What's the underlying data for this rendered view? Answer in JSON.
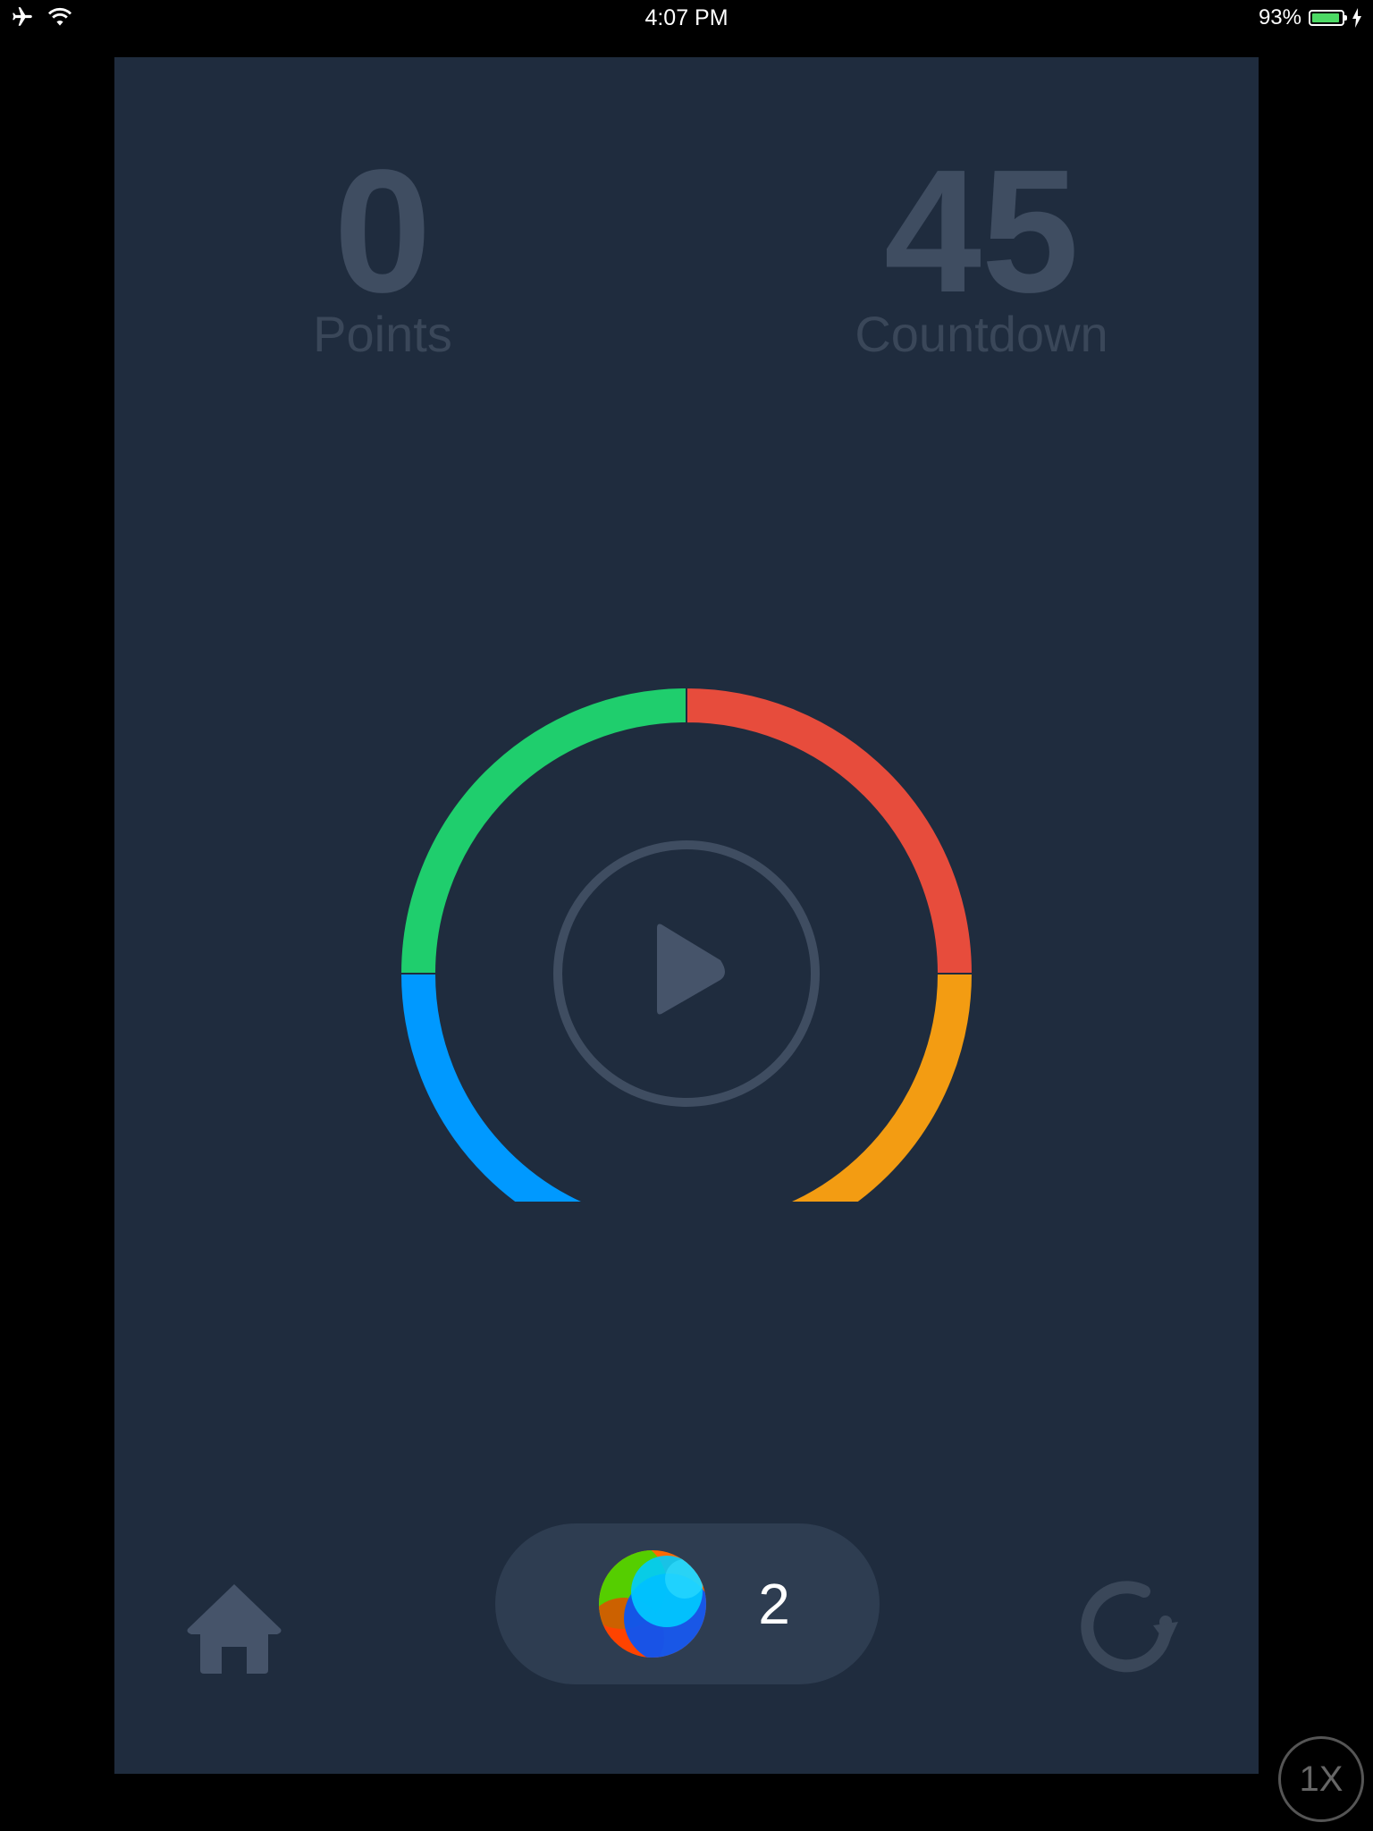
{
  "status_bar": {
    "time": "4:07 PM",
    "battery_percent": "93%",
    "battery_level": 0.93,
    "icons": [
      "airplane-icon",
      "wifi-icon",
      "charging-bolt-icon"
    ]
  },
  "stats": {
    "points_value": "0",
    "points_label": "Points",
    "countdown_value": "45",
    "countdown_label": "Countdown"
  },
  "ring": {
    "segments": [
      {
        "name": "red",
        "color": "#e74c3c"
      },
      {
        "name": "orange",
        "color": "#f39c12"
      },
      {
        "name": "blue",
        "color": "#0099ff"
      },
      {
        "name": "green",
        "color": "#1fce6d"
      }
    ],
    "center_icon": "play-icon"
  },
  "bottom_bar": {
    "balls_count": "2",
    "home_icon": "home-icon",
    "restart_icon": "restart-icon",
    "ball_icon": "colorful-ball-icon"
  },
  "speed_label": "1X",
  "colors": {
    "background": "#1f2c3e",
    "muted": "#3f4d61",
    "pill": "#2e3d51"
  }
}
